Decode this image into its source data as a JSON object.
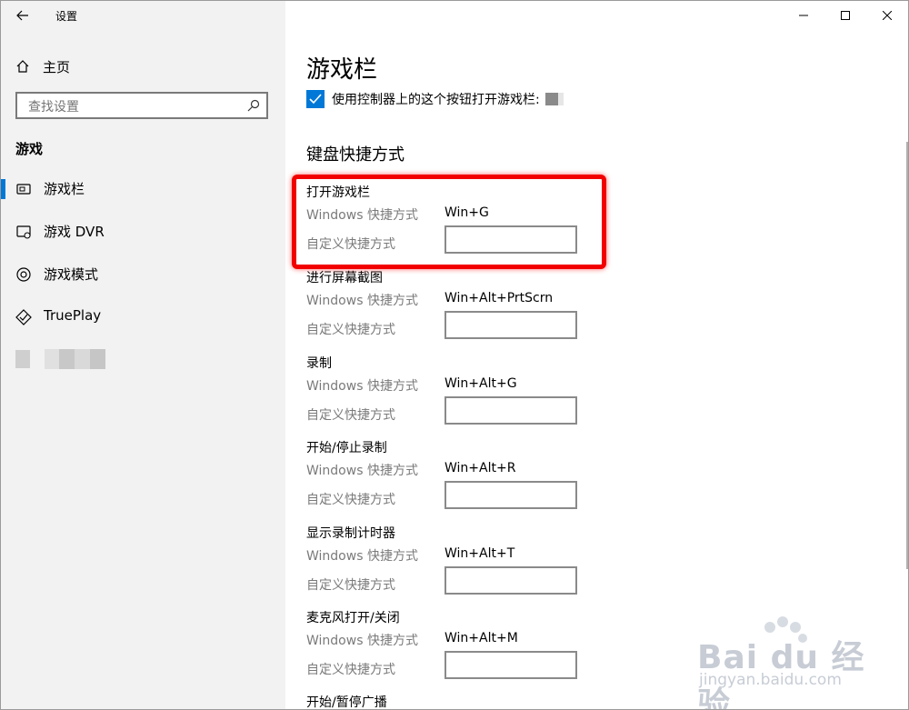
{
  "window": {
    "title": "设置"
  },
  "sidebar": {
    "home_label": "主页",
    "search_placeholder": "查找设置",
    "section_title": "游戏",
    "items": [
      {
        "label": "游戏栏",
        "icon": "game-bar-icon",
        "active": true
      },
      {
        "label": "游戏 DVR",
        "icon": "game-dvr-icon",
        "active": false
      },
      {
        "label": "游戏模式",
        "icon": "game-mode-icon",
        "active": false
      },
      {
        "label": "TruePlay",
        "icon": "trueplay-icon",
        "active": false
      }
    ]
  },
  "main": {
    "title": "游戏栏",
    "checkbox_label": "使用控制器上的这个按钮打开游戏栏:",
    "checkbox_checked": true,
    "keyboard_title": "键盘快捷方式",
    "windows_label": "Windows 快捷方式",
    "custom_label": "自定义快捷方式",
    "shortcuts": [
      {
        "name": "打开游戏栏",
        "value": "Win+G"
      },
      {
        "name": "进行屏幕截图",
        "value": "Win+Alt+PrtScrn"
      },
      {
        "name": "录制",
        "value": "Win+Alt+G"
      },
      {
        "name": "开始/停止录制",
        "value": "Win+Alt+R"
      },
      {
        "name": "显示录制计时器",
        "value": "Win+Alt+T"
      },
      {
        "name": "麦克风打开/关闭",
        "value": "Win+Alt+M"
      }
    ],
    "last_group": "开始/暂停广播"
  },
  "watermark": {
    "brand": "Bai du 经验",
    "url": "jingyan.baidu.com"
  },
  "colors": {
    "accent": "#0078d7",
    "highlight": "#f20000",
    "sidebar_bg": "#f2f2f2"
  }
}
